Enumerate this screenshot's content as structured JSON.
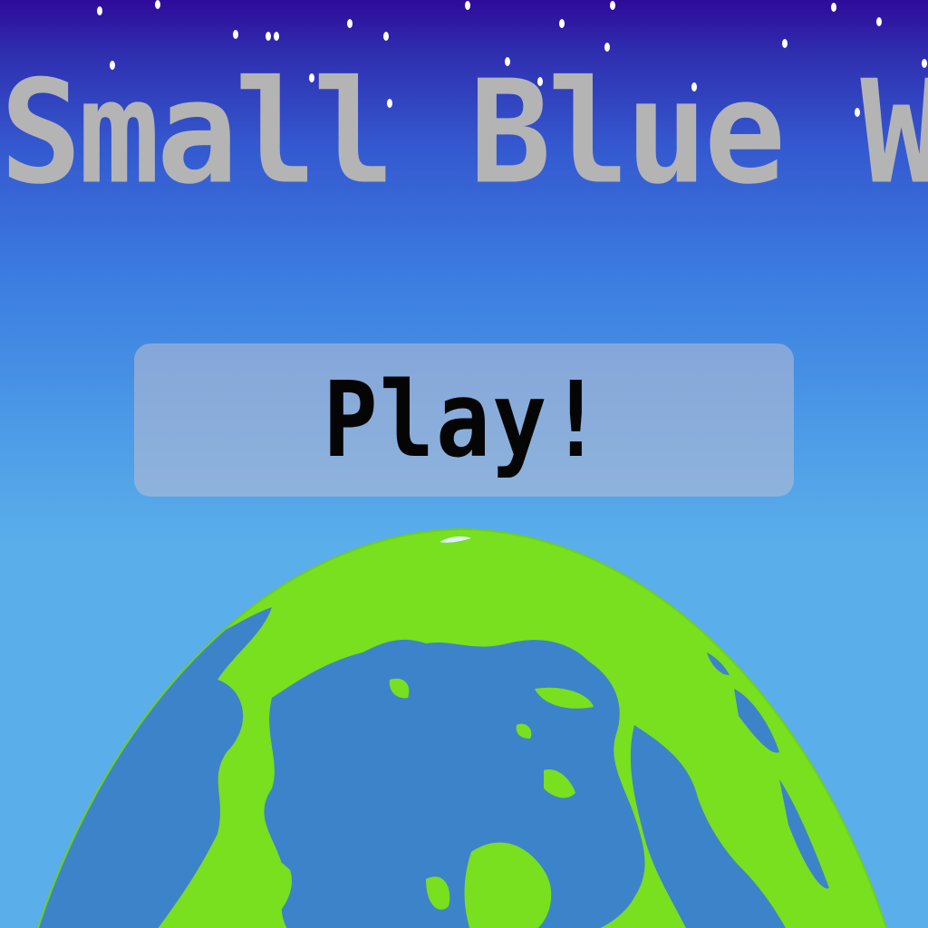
{
  "game": {
    "title": "Small Blue World",
    "play_label": "Play!"
  },
  "colors": {
    "sky_top": "#2f0a9a",
    "sky_bottom": "#5aaeea",
    "title": "#b4b4b4",
    "ocean": "#3d83c9",
    "land": "#78e01e",
    "button_label": "#050505"
  },
  "icons": {
    "globe": "earth-globe-icon",
    "stars": "starfield"
  }
}
